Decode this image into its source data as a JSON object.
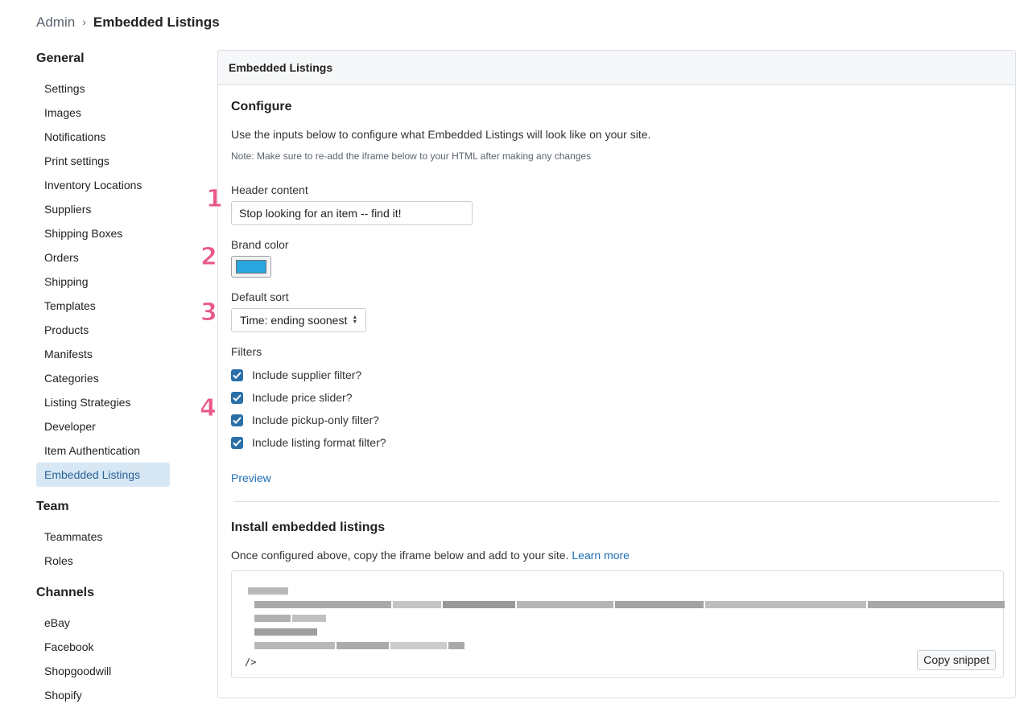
{
  "breadcrumb": {
    "parent": "Admin",
    "separator": "›",
    "current": "Embedded Listings"
  },
  "sidebar": {
    "groups": [
      {
        "title": "General",
        "items": [
          "Settings",
          "Images",
          "Notifications",
          "Print settings",
          "Inventory Locations",
          "Suppliers",
          "Shipping Boxes",
          "Orders",
          "Shipping",
          "Templates",
          "Products",
          "Manifests",
          "Categories",
          "Listing Strategies",
          "Developer",
          "Item Authentication",
          "Embedded Listings"
        ]
      },
      {
        "title": "Team",
        "items": [
          "Teammates",
          "Roles"
        ]
      },
      {
        "title": "Channels",
        "items": [
          "eBay",
          "Facebook",
          "Shopgoodwill",
          "Shopify"
        ]
      }
    ],
    "active_item": "Embedded Listings",
    "active_bg": "#d7e7f4",
    "active_color": "#2a6496"
  },
  "panel": {
    "title": "Embedded Listings",
    "configure": {
      "title": "Configure",
      "description": "Use the inputs below to configure what Embedded Listings will look like on your site.",
      "note": "Note: Make sure to re-add the iframe below to your HTML after making any changes",
      "header_content": {
        "label": "Header content",
        "value": "Stop looking for an item -- find it!"
      },
      "brand_color": {
        "label": "Brand color",
        "value": "#2aa6df"
      },
      "default_sort": {
        "label": "Default sort",
        "value": "Time: ending soonest"
      },
      "filters": {
        "label": "Filters",
        "items": [
          {
            "label": "Include supplier filter?",
            "checked": true
          },
          {
            "label": "Include price slider?",
            "checked": true
          },
          {
            "label": "Include pickup-only filter?",
            "checked": true
          },
          {
            "label": "Include listing format filter?",
            "checked": true
          }
        ],
        "check_color": "#2a6fa8"
      },
      "preview_link": "Preview"
    },
    "install": {
      "title": "Install embedded listings",
      "description": "Once configured above, copy the iframe below and add to your site.",
      "learn_more": "Learn more",
      "snippet_end": "/>",
      "copy_button": "Copy snippet"
    }
  },
  "step_markers": [
    "1",
    "2",
    "3",
    "4"
  ],
  "step_color": "#e8588a"
}
